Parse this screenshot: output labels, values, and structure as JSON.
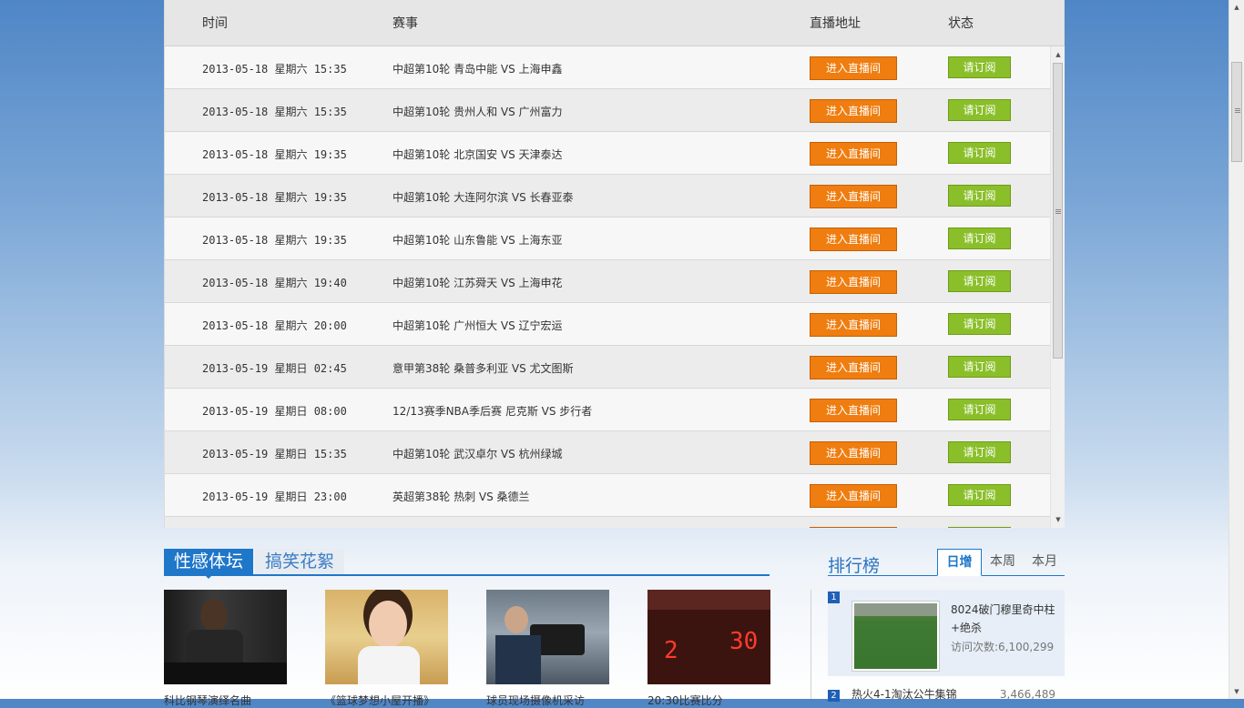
{
  "schedule": {
    "headers": {
      "time": "时间",
      "match": "赛事",
      "live": "直播地址",
      "status": "状态"
    },
    "live_label": "进入直播间",
    "subscribe_label": "请订阅",
    "rows": [
      {
        "date": "2013-05-18  星期六  15:35",
        "match": "中超第10轮 青岛中能 VS 上海申鑫"
      },
      {
        "date": "2013-05-18  星期六  15:35",
        "match": "中超第10轮 贵州人和 VS 广州富力"
      },
      {
        "date": "2013-05-18  星期六  19:35",
        "match": "中超第10轮 北京国安 VS 天津泰达"
      },
      {
        "date": "2013-05-18  星期六  19:35",
        "match": "中超第10轮 大连阿尔滨 VS 长春亚泰"
      },
      {
        "date": "2013-05-18  星期六  19:35",
        "match": "中超第10轮 山东鲁能 VS 上海东亚"
      },
      {
        "date": "2013-05-18  星期六  19:40",
        "match": "中超第10轮 江苏舜天 VS 上海申花"
      },
      {
        "date": "2013-05-18  星期六  20:00",
        "match": "中超第10轮 广州恒大 VS 辽宁宏运"
      },
      {
        "date": "2013-05-19  星期日  02:45",
        "match": "意甲第38轮 桑普多利亚 VS 尤文图斯"
      },
      {
        "date": "2013-05-19  星期日  08:00",
        "match": "12/13赛季NBA季后赛 尼克斯 VS 步行者"
      },
      {
        "date": "2013-05-19  星期日  15:35",
        "match": "中超第10轮 武汉卓尔 VS 杭州绿城"
      },
      {
        "date": "2013-05-19  星期日  23:00",
        "match": "英超第38轮 热刺 VS 桑德兰"
      }
    ]
  },
  "gallery": {
    "tabs": [
      "性感体坛",
      "搞笑花絮"
    ],
    "items": [
      {
        "caption": "科比钢琴演绎名曲"
      },
      {
        "caption": "《篮球梦想小屋开播》"
      },
      {
        "caption": "球员现场摄像机采访"
      },
      {
        "caption": "20:30比赛比分"
      }
    ]
  },
  "rank": {
    "title": "排行榜",
    "tabs": [
      "日增",
      "本周",
      "本月"
    ],
    "items": [
      {
        "num": "1",
        "title": "8024破门穆里奇中柱+绝杀",
        "views": "访问次数:6,100,299"
      },
      {
        "num": "2",
        "title": "热火4-1淘汰公牛集锦",
        "views": "3,466,489"
      }
    ]
  },
  "colors": {
    "live_button": "#ef7d0f",
    "subscribe_button": "#8abf2a",
    "accent_blue": "#1f77c9"
  }
}
